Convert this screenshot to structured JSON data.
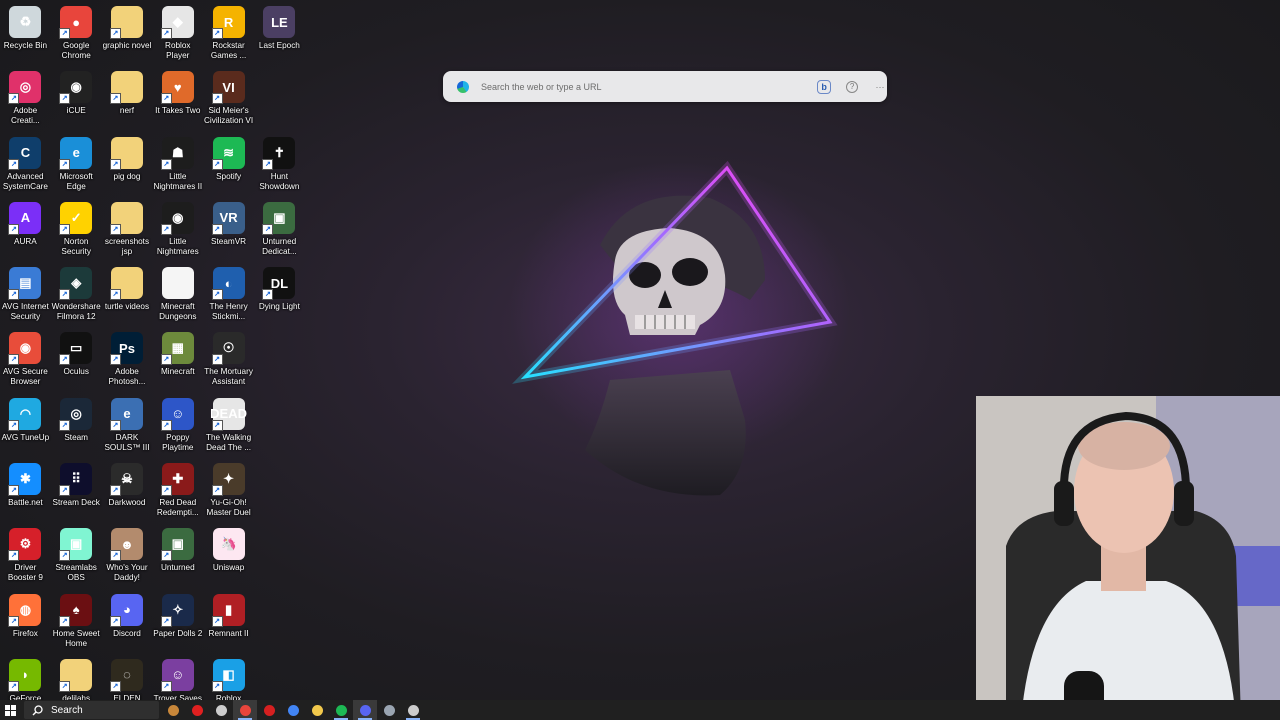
{
  "desktop": {
    "icons": [
      {
        "label": "Recycle Bin",
        "icon": "recycle-bin-icon",
        "color": "#cfd8dc",
        "glyph": "♻",
        "shortcut": false
      },
      {
        "label": "Google Chrome",
        "icon": "chrome-icon",
        "color": "#e8453c",
        "glyph": "●",
        "shortcut": true
      },
      {
        "label": "graphic novel",
        "icon": "folder-icon",
        "color": "#f2d27a",
        "glyph": "",
        "shortcut": true
      },
      {
        "label": "Roblox Player",
        "icon": "roblox-icon",
        "color": "#e6e6e6",
        "glyph": "◆",
        "shortcut": true
      },
      {
        "label": "Rockstar Games ...",
        "icon": "rockstar-icon",
        "color": "#f5b300",
        "glyph": "R",
        "shortcut": true
      },
      {
        "label": "Last Epoch",
        "icon": "last-epoch-icon",
        "color": "#4b3f63",
        "glyph": "LE",
        "shortcut": false
      },
      {
        "label": "Adobe Creati...",
        "icon": "adobe-cc-icon",
        "color": "#e0316a",
        "glyph": "◎",
        "shortcut": true
      },
      {
        "label": "iCUE",
        "icon": "icue-icon",
        "color": "#222222",
        "glyph": "◉",
        "shortcut": true
      },
      {
        "label": "nerf",
        "icon": "folder-icon",
        "color": "#f2d27a",
        "glyph": "",
        "shortcut": true
      },
      {
        "label": "It Takes Two",
        "icon": "it-takes-two-icon",
        "color": "#e06a2a",
        "glyph": "♥",
        "shortcut": true
      },
      {
        "label": "Sid Meier's Civilization VI",
        "icon": "civ6-icon",
        "color": "#5a2b1d",
        "glyph": "VI",
        "shortcut": true
      },
      {
        "label": "",
        "icon": "",
        "color": "",
        "glyph": "",
        "shortcut": false
      },
      {
        "label": "Advanced SystemCare",
        "icon": "systemcare-icon",
        "color": "#0f3e6b",
        "glyph": "C",
        "shortcut": true
      },
      {
        "label": "Microsoft Edge",
        "icon": "edge-icon",
        "color": "#1a8fd8",
        "glyph": "e",
        "shortcut": true
      },
      {
        "label": "pig dog",
        "icon": "folder-icon",
        "color": "#f2d27a",
        "glyph": "",
        "shortcut": true
      },
      {
        "label": "Little Nightmares II",
        "icon": "little-nightmares-2-icon",
        "color": "#1d1d1d",
        "glyph": "☗",
        "shortcut": true
      },
      {
        "label": "Spotify",
        "icon": "spotify-icon",
        "color": "#1db954",
        "glyph": "≋",
        "shortcut": true
      },
      {
        "label": "Hunt Showdown",
        "icon": "hunt-showdown-icon",
        "color": "#111111",
        "glyph": "✝",
        "shortcut": true
      },
      {
        "label": "AURA",
        "icon": "aura-icon",
        "color": "#7b2ff7",
        "glyph": "A",
        "shortcut": true
      },
      {
        "label": "Norton Security",
        "icon": "norton-icon",
        "color": "#ffd200",
        "glyph": "✓",
        "shortcut": true
      },
      {
        "label": "screenshots jsp",
        "icon": "folder-icon",
        "color": "#f2d27a",
        "glyph": "",
        "shortcut": true
      },
      {
        "label": "Little Nightmares",
        "icon": "little-nightmares-icon",
        "color": "#1d1d1d",
        "glyph": "◉",
        "shortcut": true
      },
      {
        "label": "SteamVR",
        "icon": "steamvr-icon",
        "color": "#3a5f8a",
        "glyph": "VR",
        "shortcut": true
      },
      {
        "label": "Unturned Dedicat...",
        "icon": "unturned-icon",
        "color": "#3b6b40",
        "glyph": "▣",
        "shortcut": true
      },
      {
        "label": "AVG Internet Security",
        "icon": "avg-is-icon",
        "color": "#3a7bd5",
        "glyph": "▤",
        "shortcut": true
      },
      {
        "label": "Wondershare Filmora 12",
        "icon": "filmora-icon",
        "color": "#1c3a3a",
        "glyph": "◈",
        "shortcut": true
      },
      {
        "label": "turtle videos",
        "icon": "folder-icon",
        "color": "#f2d27a",
        "glyph": "",
        "shortcut": true
      },
      {
        "label": "Minecraft Dungeons",
        "icon": "file-icon",
        "color": "#f5f5f5",
        "glyph": "",
        "shortcut": false
      },
      {
        "label": "The Henry Stickmi...",
        "icon": "henry-stickmin-icon",
        "color": "#1f5fae",
        "glyph": "◐",
        "shortcut": true
      },
      {
        "label": "Dying Light",
        "icon": "dying-light-icon",
        "color": "#111111",
        "glyph": "DL",
        "shortcut": true
      },
      {
        "label": "AVG Secure Browser",
        "icon": "avg-browser-icon",
        "color": "#e84d3a",
        "glyph": "◉",
        "shortcut": true
      },
      {
        "label": "Oculus",
        "icon": "oculus-icon",
        "color": "#111111",
        "glyph": "▭",
        "shortcut": true
      },
      {
        "label": "Adobe Photosh...",
        "icon": "photoshop-icon",
        "color": "#001e36",
        "glyph": "Ps",
        "shortcut": true
      },
      {
        "label": "Minecraft",
        "icon": "minecraft-icon",
        "color": "#6d8a3c",
        "glyph": "▦",
        "shortcut": true
      },
      {
        "label": "The Mortuary Assistant",
        "icon": "mortuary-icon",
        "color": "#2a2a2a",
        "glyph": "☉",
        "shortcut": true
      },
      {
        "label": "",
        "icon": "",
        "color": "",
        "glyph": "",
        "shortcut": false
      },
      {
        "label": "AVG TuneUp",
        "icon": "avg-tuneup-icon",
        "color": "#1fa9e1",
        "glyph": "◠",
        "shortcut": true
      },
      {
        "label": "Steam",
        "icon": "steam-icon",
        "color": "#1b2838",
        "glyph": "◎",
        "shortcut": true
      },
      {
        "label": "DARK SOULS™ III",
        "icon": "dark-souls-3-icon",
        "color": "#3b6fb3",
        "glyph": "e",
        "shortcut": true
      },
      {
        "label": "Poppy Playtime",
        "icon": "poppy-playtime-icon",
        "color": "#2d56c8",
        "glyph": "☺",
        "shortcut": true
      },
      {
        "label": "The Walking Dead The ...",
        "icon": "walking-dead-icon",
        "color": "#e6e6e6",
        "glyph": "DEAD",
        "shortcut": true
      },
      {
        "label": "",
        "icon": "",
        "color": "",
        "glyph": "",
        "shortcut": false
      },
      {
        "label": "Battle.net",
        "icon": "battlenet-icon",
        "color": "#148eff",
        "glyph": "✱",
        "shortcut": true
      },
      {
        "label": "Stream Deck",
        "icon": "stream-deck-icon",
        "color": "#0e0e2c",
        "glyph": "⠿",
        "shortcut": true
      },
      {
        "label": "Darkwood",
        "icon": "darkwood-icon",
        "color": "#2b2b2b",
        "glyph": "☠",
        "shortcut": true
      },
      {
        "label": "Red Dead Redempti...",
        "icon": "rdr2-icon",
        "color": "#8a1a1a",
        "glyph": "✚",
        "shortcut": true
      },
      {
        "label": "Yu-Gi-Oh! Master Duel",
        "icon": "yugioh-icon",
        "color": "#4a3b2a",
        "glyph": "✦",
        "shortcut": true
      },
      {
        "label": "",
        "icon": "",
        "color": "",
        "glyph": "",
        "shortcut": false
      },
      {
        "label": "Driver Booster 9",
        "icon": "driver-booster-icon",
        "color": "#d6202a",
        "glyph": "⚙",
        "shortcut": true
      },
      {
        "label": "Streamlabs OBS",
        "icon": "streamlabs-icon",
        "color": "#80f5d2",
        "glyph": "▣",
        "shortcut": true
      },
      {
        "label": "Who's Your Daddy!",
        "icon": "whos-your-daddy-icon",
        "color": "#b38b6d",
        "glyph": "☻",
        "shortcut": true
      },
      {
        "label": "Unturned",
        "icon": "unturned-icon",
        "color": "#3b6b40",
        "glyph": "▣",
        "shortcut": true
      },
      {
        "label": "Uniswap",
        "icon": "uniswap-icon",
        "color": "#fde7f1",
        "glyph": "🦄",
        "shortcut": false
      },
      {
        "label": "",
        "icon": "",
        "color": "",
        "glyph": "",
        "shortcut": false
      },
      {
        "label": "Firefox",
        "icon": "firefox-icon",
        "color": "#ff7139",
        "glyph": "◍",
        "shortcut": true
      },
      {
        "label": "Home Sweet Home",
        "icon": "home-sweet-home-icon",
        "color": "#6b0f12",
        "glyph": "♠",
        "shortcut": true
      },
      {
        "label": "Discord",
        "icon": "discord-icon",
        "color": "#5865f2",
        "glyph": "◕",
        "shortcut": true
      },
      {
        "label": "Paper Dolls 2",
        "icon": "paper-dolls-icon",
        "color": "#1a2a4a",
        "glyph": "✧",
        "shortcut": true
      },
      {
        "label": "Remnant II",
        "icon": "remnant-icon",
        "color": "#b01f24",
        "glyph": "▮",
        "shortcut": true
      },
      {
        "label": "",
        "icon": "",
        "color": "",
        "glyph": "",
        "shortcut": false
      },
      {
        "label": "GeForce",
        "icon": "geforce-icon",
        "color": "#76b900",
        "glyph": "◗",
        "shortcut": true
      },
      {
        "label": "delilahs",
        "icon": "folder-icon",
        "color": "#f2d27a",
        "glyph": "",
        "shortcut": true
      },
      {
        "label": "ELDEN RING",
        "icon": "elden-ring-icon",
        "color": "#2f2a1e",
        "glyph": "◌",
        "shortcut": true
      },
      {
        "label": "Trover Saves",
        "icon": "trover-icon",
        "color": "#7b3fa0",
        "glyph": "☺",
        "shortcut": true
      },
      {
        "label": "Roblox",
        "icon": "roblox-studio-icon",
        "color": "#1aa0e6",
        "glyph": "◧",
        "shortcut": true
      },
      {
        "label": "",
        "icon": "",
        "color": "",
        "glyph": "",
        "shortcut": false
      }
    ]
  },
  "search": {
    "placeholder": "Search the web or type a URL",
    "bing_label": "b",
    "help_label": "?",
    "more_label": "···"
  },
  "taskbar": {
    "search_label": "Search",
    "apps": [
      {
        "name": "gingerbread-widget-icon",
        "color": "#c8873a",
        "active": false,
        "focused": false
      },
      {
        "name": "record-icon",
        "color": "#e02020",
        "active": false,
        "focused": false
      },
      {
        "name": "task-view-icon",
        "color": "#cccccc",
        "active": false,
        "focused": false
      },
      {
        "name": "chrome-taskbar-icon",
        "color": "#e8453c",
        "active": true,
        "focused": true
      },
      {
        "name": "obs-taskbar-icon",
        "color": "#d62020",
        "active": false,
        "focused": false
      },
      {
        "name": "chrome-profile-icon",
        "color": "#4285f4",
        "active": false,
        "focused": false
      },
      {
        "name": "file-explorer-icon",
        "color": "#f2c94c",
        "active": false,
        "focused": false
      },
      {
        "name": "spotify-taskbar-icon",
        "color": "#1db954",
        "active": true,
        "focused": false
      },
      {
        "name": "discord-taskbar-icon",
        "color": "#5865f2",
        "active": true,
        "focused": true
      },
      {
        "name": "steam-taskbar-icon",
        "color": "#9aa5b1",
        "active": false,
        "focused": false
      },
      {
        "name": "terminal-icon",
        "color": "#cccccc",
        "active": true,
        "focused": false
      }
    ]
  }
}
